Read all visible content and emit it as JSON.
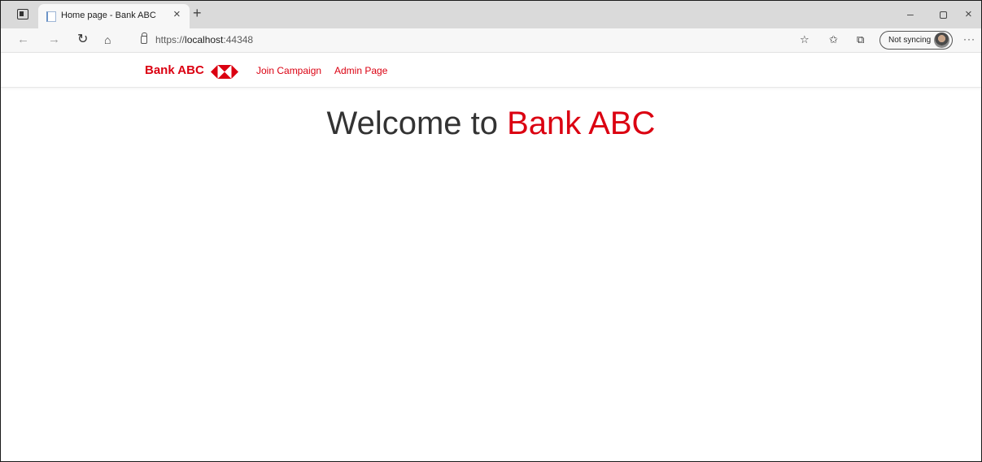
{
  "browser": {
    "tab_title": "Home page - Bank ABC",
    "tab_close": "×",
    "new_tab": "+",
    "url_scheme": "https://",
    "url_host": "localhost",
    "url_port": ":44348",
    "sync_label": "Not syncing",
    "more": "···",
    "window_min": "–",
    "window_close": "×",
    "icons": [
      "tab-actions-icon",
      "back-icon",
      "forward-icon",
      "refresh-icon",
      "home-icon",
      "lock-icon",
      "add-favorite-icon",
      "favorites-icon",
      "collections-icon",
      "avatar"
    ]
  },
  "site": {
    "brand": "Bank ABC",
    "nav": [
      "Join Campaign",
      "Admin Page"
    ],
    "welcome_prefix": "Welcome to ",
    "welcome_accent": "Bank ABC",
    "brand_color": "#db0011"
  }
}
